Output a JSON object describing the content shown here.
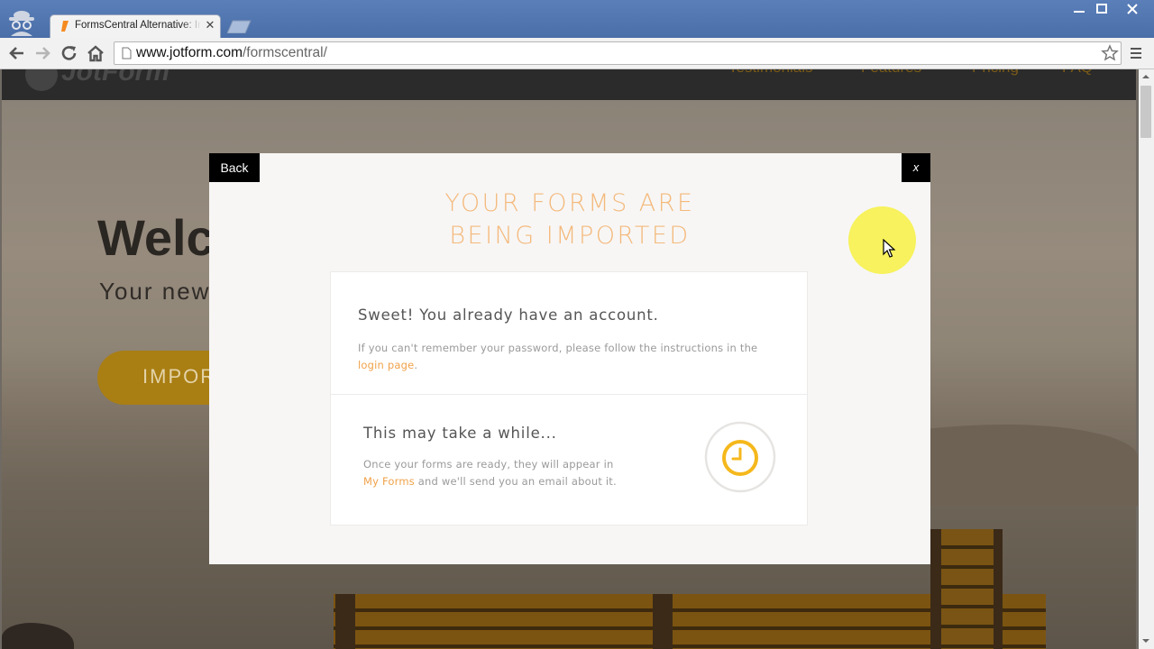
{
  "browser": {
    "tab": {
      "title": "FormsCentral Alternative: Import"
    },
    "url": {
      "host": "www.jotform.com",
      "path": "/formscentral/"
    }
  },
  "site": {
    "nav": [
      "Testimonials",
      "Features",
      "Pricing",
      "FAQ"
    ],
    "hero": {
      "title": "Welcome",
      "subtitle": "Your new",
      "button_label": "IMPORT"
    }
  },
  "modal": {
    "back_label": "Back",
    "close_label": "x",
    "title": "YOUR FORMS ARE\nBEING IMPORTED",
    "account": {
      "heading": "Sweet! You already have an account.",
      "text_before_link": "If you can't remember your password, please follow the instructions in the ",
      "link": "login page",
      "text_after_link": "."
    },
    "waiting": {
      "heading": "This may take a while...",
      "text_line1": "Once your forms are ready, they will appear in",
      "link": "My Forms",
      "text_after_link": " and we'll send you an email about it."
    }
  },
  "colors": {
    "accent": "#f4b97b",
    "link": "#f0a24a",
    "clock": "#f5b81c"
  }
}
